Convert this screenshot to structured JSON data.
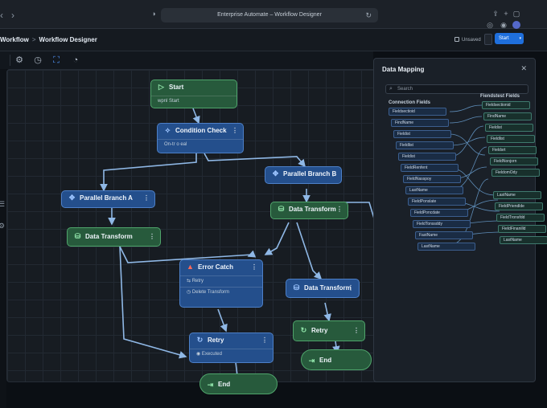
{
  "browser": {
    "address": "Enterprise Automate – Workflow Designer"
  },
  "header": {
    "breadcrumb": [
      "Workflow",
      "Workflow Designer"
    ],
    "unsaved_label": "Unsaved",
    "start_button": "Start"
  },
  "toolbar": {
    "tools": [
      "gear-icon",
      "clock-icon",
      "flow-icon",
      "time-icon"
    ],
    "active_tool": "flow-icon"
  },
  "nodes": {
    "start": {
      "title": "Start",
      "subtitle": "wpnl Start"
    },
    "condition": {
      "title": "Condition Check",
      "subtitle": "On-tr o eal"
    },
    "branch_a": {
      "title": "Parallel Branch A"
    },
    "branch_b": {
      "title": "Parallel Branch B"
    },
    "transform_a": {
      "title": "Data Transform"
    },
    "transform_b": {
      "title": "Data Transform"
    },
    "transform_c": {
      "title": "Data Transform"
    },
    "error": {
      "title": "Error Catch",
      "retry_label": "Retry",
      "delete_label": "Delete Transform"
    },
    "retry_a": {
      "title": "Retry",
      "subtitle": "Executed"
    },
    "retry_b": {
      "title": "Retry"
    },
    "end_a": {
      "title": "End"
    },
    "end_b": {
      "title": "End"
    }
  },
  "data_mapping": {
    "title": "Data Mapping",
    "search_placeholder": "Search",
    "source_header": "Connection Fields",
    "target_header": "Fiendstest Fields",
    "source_fields": [
      "Fieldsectioid",
      "FindName",
      "Fieldist",
      "Fieldlist",
      "Fieldist",
      "FieldRenfent",
      "FieldNasspoy",
      "LastName",
      "FieldPonslate",
      "FieldPoncdate",
      "FieldTonssddy",
      "FastName",
      "LastName"
    ],
    "target_fields": [
      "Fieldsectionid",
      "FindName",
      "Fieldist",
      "Fieldlist",
      "Fieldsrt",
      "FieldNonjorn",
      "FieldomOdy",
      "LastName",
      "FieldPriendlde",
      "FieldTronsfdd",
      "FieldFinanilld",
      "LastName"
    ]
  },
  "colors": {
    "green_node": "#275a3c",
    "blue_node": "#244f8c",
    "accent": "#1f6fdc",
    "edge": "#8fb8e6"
  }
}
